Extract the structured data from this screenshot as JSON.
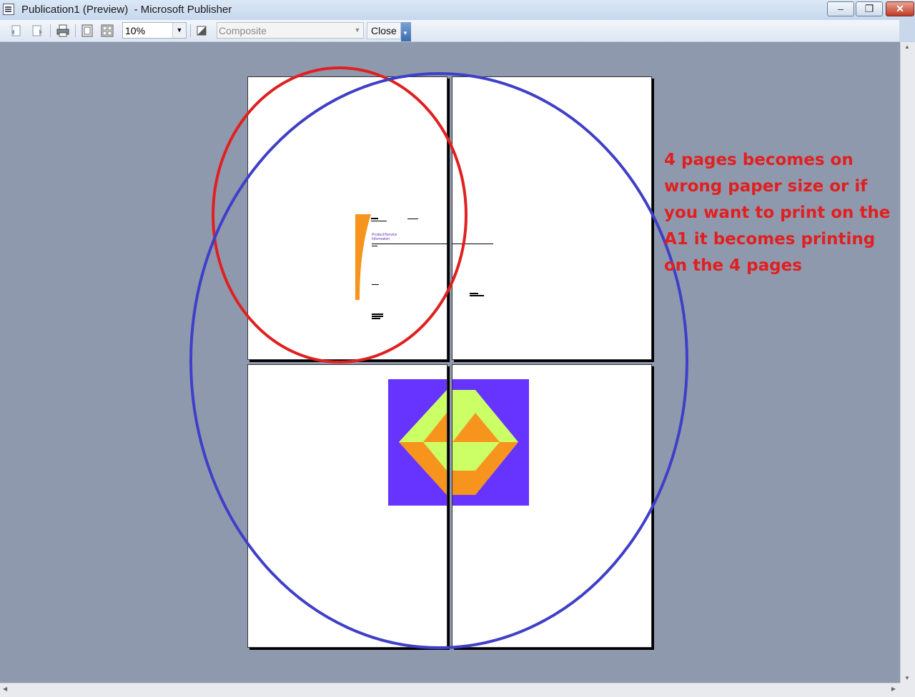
{
  "window": {
    "title": "Publication1 (Preview)  - Microsoft Publisher",
    "min_symbol": "–",
    "max_symbol": "❐",
    "close_symbol": "✕"
  },
  "toolbar": {
    "zoom_value": "10%",
    "color_mode": "Composite",
    "close_label": "Close",
    "dropdown_arrow": "▼"
  },
  "preview_page": {
    "title_line1": "Product/Service",
    "title_line2": "Information"
  },
  "annotation": {
    "text": "4 pages becomes on wrong paper size or if you want to print on the A1 it becomes printing on the 4 pages",
    "color": "#e02020"
  },
  "colors": {
    "canvas": "#8f99ae",
    "orange": "#f7941d",
    "purple": "#6633ff",
    "lime": "#ccff66",
    "red_circle": "#e02020",
    "blue_circle": "#3f3fc8"
  }
}
